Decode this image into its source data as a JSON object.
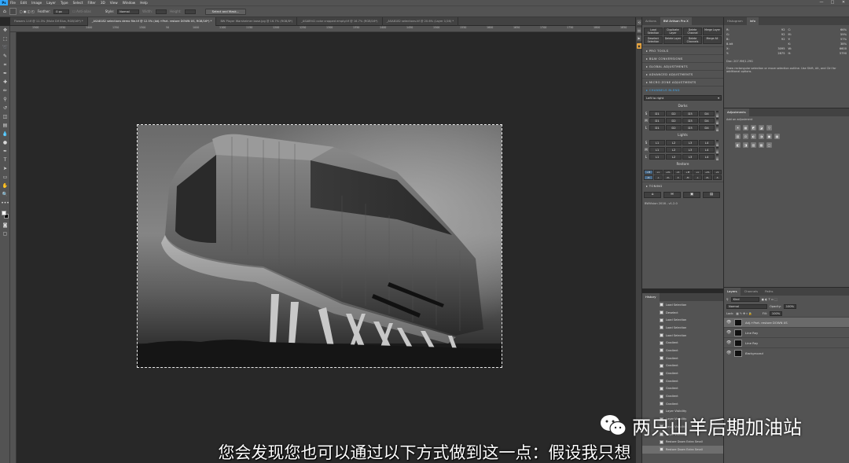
{
  "menubar": {
    "logo": "Ps",
    "items": [
      "File",
      "Edit",
      "Image",
      "Layer",
      "Type",
      "Select",
      "Filter",
      "3D",
      "View",
      "Window",
      "Help"
    ],
    "window_controls": [
      "—",
      "□",
      "✕"
    ]
  },
  "options": {
    "feather_label": "Feather:",
    "feather_value": "0 px",
    "style_label": "Style:",
    "style_value": "Normal",
    "width_label": "Width:",
    "height_label": "Height:",
    "select_mask_button": "Select and Mask..."
  },
  "tabs": [
    "Flowers 1.tif @ 11.3% (Mute Dif Blus, RGB/16*) *",
    "_ASA8182 selections demo file.tif @ 12.5% (Adj.+Part. restore DOWN XS, RGB/16*) *",
    "BW Player Warsheimer base.jpg @ 16.7% (RGB/8*)",
    "_ASA8941 color cropped empty.tif @ 16.7% (RGB/16*)",
    "_ASA8182 selections.tif @ 20.6% (Layer 1/16) *"
  ],
  "ruler": [
    "1500",
    "1550",
    "1400",
    "1350",
    "1300",
    "50",
    "1000",
    "1100",
    "1150",
    "1200",
    "1250",
    "1300",
    "1350",
    "1400",
    "1450",
    "1500",
    "1550",
    "1600",
    "1650",
    "1700",
    "1750",
    "1800",
    "1850"
  ],
  "bwpanel": {
    "tabs": [
      "Actions",
      "BW Artisan Pro X"
    ],
    "buttons": [
      "Load Selection",
      "Duplicate Layer",
      "Delete Channel",
      "Merge Layer",
      "Deselect Selection",
      "Delete Layer",
      "Delete Channels",
      "Merge All"
    ],
    "sections": [
      "PRO TOOLS",
      "B&W CONVERSIONS",
      "GLOBAL ADJUSTMENTS",
      "ADVANCED ADJUSTMENTS",
      "MICRO ZONE ADJUSTMENTS",
      "CHANNELS BLEND"
    ],
    "dropdown": "Left to right",
    "darks_title": "Darks",
    "darks_rows": [
      {
        "label": "S",
        "cells": [
          "D1",
          "D2",
          "D3",
          "D4"
        ]
      },
      {
        "label": "M",
        "cells": [
          "D1",
          "D2",
          "D3",
          "D4"
        ]
      },
      {
        "label": "L",
        "cells": [
          "D1",
          "D2",
          "D3",
          "D4"
        ]
      }
    ],
    "lights_title": "Lights",
    "lights_rows": [
      {
        "label": "S",
        "cells": [
          "L1",
          "L2",
          "L3",
          "L4"
        ]
      },
      {
        "label": "M",
        "cells": [
          "L1",
          "L2",
          "L3",
          "L4"
        ]
      },
      {
        "label": "L",
        "cells": [
          "L1",
          "L2",
          "L3",
          "L4"
        ]
      }
    ],
    "restore_title": "Restore",
    "restore_cells": [
      "+M",
      "+L",
      "+XL",
      "+S",
      "+M",
      "+L",
      "+XL",
      "+S",
      "-M",
      "-L",
      "-XL",
      "-S",
      "-M",
      "-L",
      "-XL",
      "-S"
    ],
    "toning_title": "TONING",
    "toning_buttons": [
      "⌂",
      "✉",
      "▣",
      "▤"
    ],
    "version": "BWVision 2016 - v1.2.0"
  },
  "info": {
    "tabs": [
      "Histogram",
      "Info"
    ],
    "cells": [
      {
        "k": "R:",
        "v": "92"
      },
      {
        "k": "C:",
        "v": "66%"
      },
      {
        "k": "G:",
        "v": "92"
      },
      {
        "k": "M:",
        "v": "59%"
      },
      {
        "k": "B:",
        "v": "92"
      },
      {
        "k": "Y:",
        "v": "57%"
      },
      {
        "k": "8-bit",
        "v": ""
      },
      {
        "k": "K:",
        "v": "38%"
      },
      {
        "k": "X:",
        "v": "3095"
      },
      {
        "k": "W:",
        "v": "6600"
      },
      {
        "k": "Y:",
        "v": "2875"
      },
      {
        "k": "H:",
        "v": "5790"
      }
    ],
    "doc": "Doc: 207.9M/1.29G",
    "hint": "Draw rectangular selection or move selection outline. Use Shift, Alt, and Ctrl for additional options."
  },
  "adjustments": {
    "title": "Adjustments",
    "subtitle": "Add an adjustment",
    "row1": [
      "☀",
      "▦",
      "◩",
      "◪",
      "▽"
    ],
    "row2": [
      "▥",
      "⚖",
      "◐",
      "◑",
      "▣",
      "▦"
    ],
    "row3": [
      "◧",
      "◨",
      "▨",
      "▩",
      "▢"
    ]
  },
  "history": {
    "title": "History",
    "items": [
      "Load Selection",
      "Deselect",
      "Load Selection",
      "Load Selection",
      "Load Selection",
      "Gradient",
      "Gradient",
      "Gradient",
      "Gradient",
      "Gradient",
      "Gradient",
      "Gradient",
      "Gradient",
      "Gradient",
      "Layer Visibility",
      "Layer Visibility",
      "Layer Visibility",
      "Layer Visibility",
      "Restore Down Extra Small",
      "Restore Down Extra Small"
    ]
  },
  "layers": {
    "tabs": [
      "Layers",
      "Channels",
      "Paths"
    ],
    "kind": "Kind",
    "blend_mode": "Normal",
    "opacity_label": "Opacity:",
    "opacity": "100%",
    "lock_label": "Lock:",
    "fill_label": "Fill:",
    "fill": "100%",
    "rows": [
      {
        "name": "Adj.+Part. restore DOWN XS",
        "thumb": "dark",
        "selected": true
      },
      {
        "name": "Line Ray",
        "thumb": "dark",
        "selected": false
      },
      {
        "name": "Line Ray",
        "thumb": "dark",
        "selected": false
      },
      {
        "name": "Background",
        "thumb": "dark",
        "selected": false
      }
    ]
  },
  "subtitle": "您会发现您也可以通过以下方式做到这一点：假设我只想",
  "watermark": "两只山羊后期加油站"
}
